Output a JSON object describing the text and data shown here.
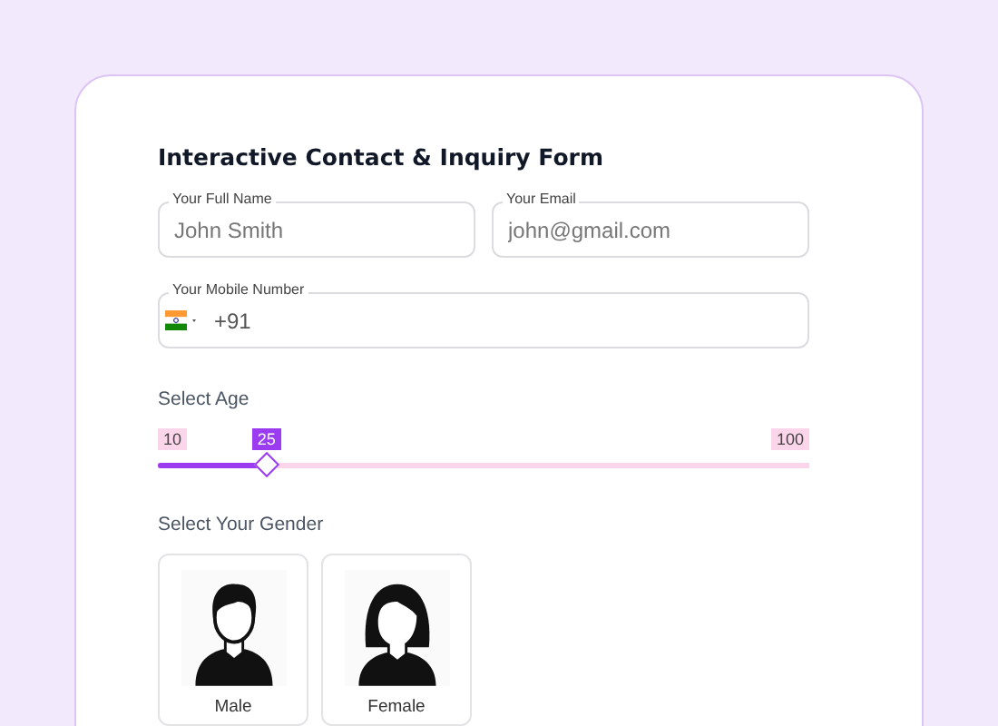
{
  "form": {
    "title": "Interactive Contact & Inquiry Form",
    "fields": [
      {
        "label": "Your Full Name",
        "placeholder": "John Smith"
      },
      {
        "label": "Your Email",
        "placeholder": "john@gmail.com"
      }
    ],
    "mobile": {
      "label": "Your Mobile Number",
      "dial_code": "+91"
    },
    "age": {
      "label": "Select Age",
      "min": "10",
      "max": "100",
      "value": "25",
      "level": 0.1667
    },
    "gender": {
      "label": "Select Your Gender",
      "options": [
        {
          "kind": "male",
          "label": "Male",
          "selected": false
        },
        {
          "kind": "female",
          "label": "Female",
          "selected": false
        }
      ]
    }
  }
}
